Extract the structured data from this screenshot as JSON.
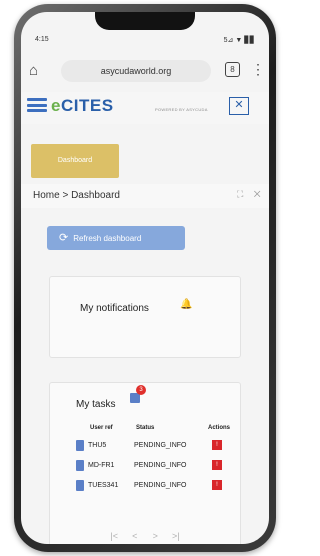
{
  "status_bar": {
    "time": "4:15",
    "icons": "5⊿ ▼ ▊▊"
  },
  "browser": {
    "url": "asycudaworld.org",
    "tabs_count": "8",
    "menu": "⋮",
    "home": "⌂"
  },
  "app": {
    "logo_e": "e",
    "logo_text": "CITES",
    "logo_subtitle": "POWERED BY ASYCUDA",
    "close_label": "✕"
  },
  "gold_button": {
    "label": "Dashboard"
  },
  "breadcrumb": {
    "text": "Home > Dashboard",
    "tools": "⛶ ✕"
  },
  "refresh": {
    "icon": "⟳",
    "label": "Refresh dashboard"
  },
  "notifications": {
    "title": "My notifications",
    "bell": "🔔"
  },
  "tasks": {
    "title": "My tasks",
    "badge": "3",
    "columns": [
      "User ref",
      "Status",
      "Actions"
    ],
    "rows": [
      {
        "ref": "THU5",
        "status": "PENDING_INFO",
        "action": "!"
      },
      {
        "ref": "MD-FR1",
        "status": "PENDING_INFO",
        "action": "!"
      },
      {
        "ref": "TUES341",
        "status": "PENDING_INFO",
        "action": "!"
      }
    ],
    "pager": [
      "|<",
      "<",
      ">",
      ">|"
    ]
  }
}
